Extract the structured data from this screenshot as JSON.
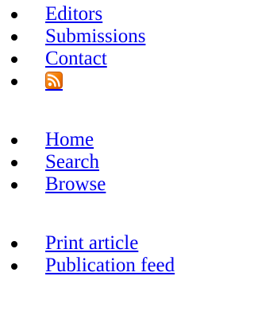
{
  "nav_primary": {
    "items": [
      {
        "label": "Editors"
      },
      {
        "label": "Submissions"
      },
      {
        "label": "Contact"
      }
    ],
    "rss_icon": "rss-feed-icon"
  },
  "nav_secondary": {
    "items": [
      {
        "label": "Home"
      },
      {
        "label": "Search"
      },
      {
        "label": "Browse"
      }
    ]
  },
  "nav_tools": {
    "items": [
      {
        "label": "Print article"
      },
      {
        "label": "Publication feed"
      }
    ]
  },
  "colors": {
    "link": "#0000ee",
    "text": "#000000",
    "rss_orange": "#f57c00",
    "background": "#ffffff"
  }
}
